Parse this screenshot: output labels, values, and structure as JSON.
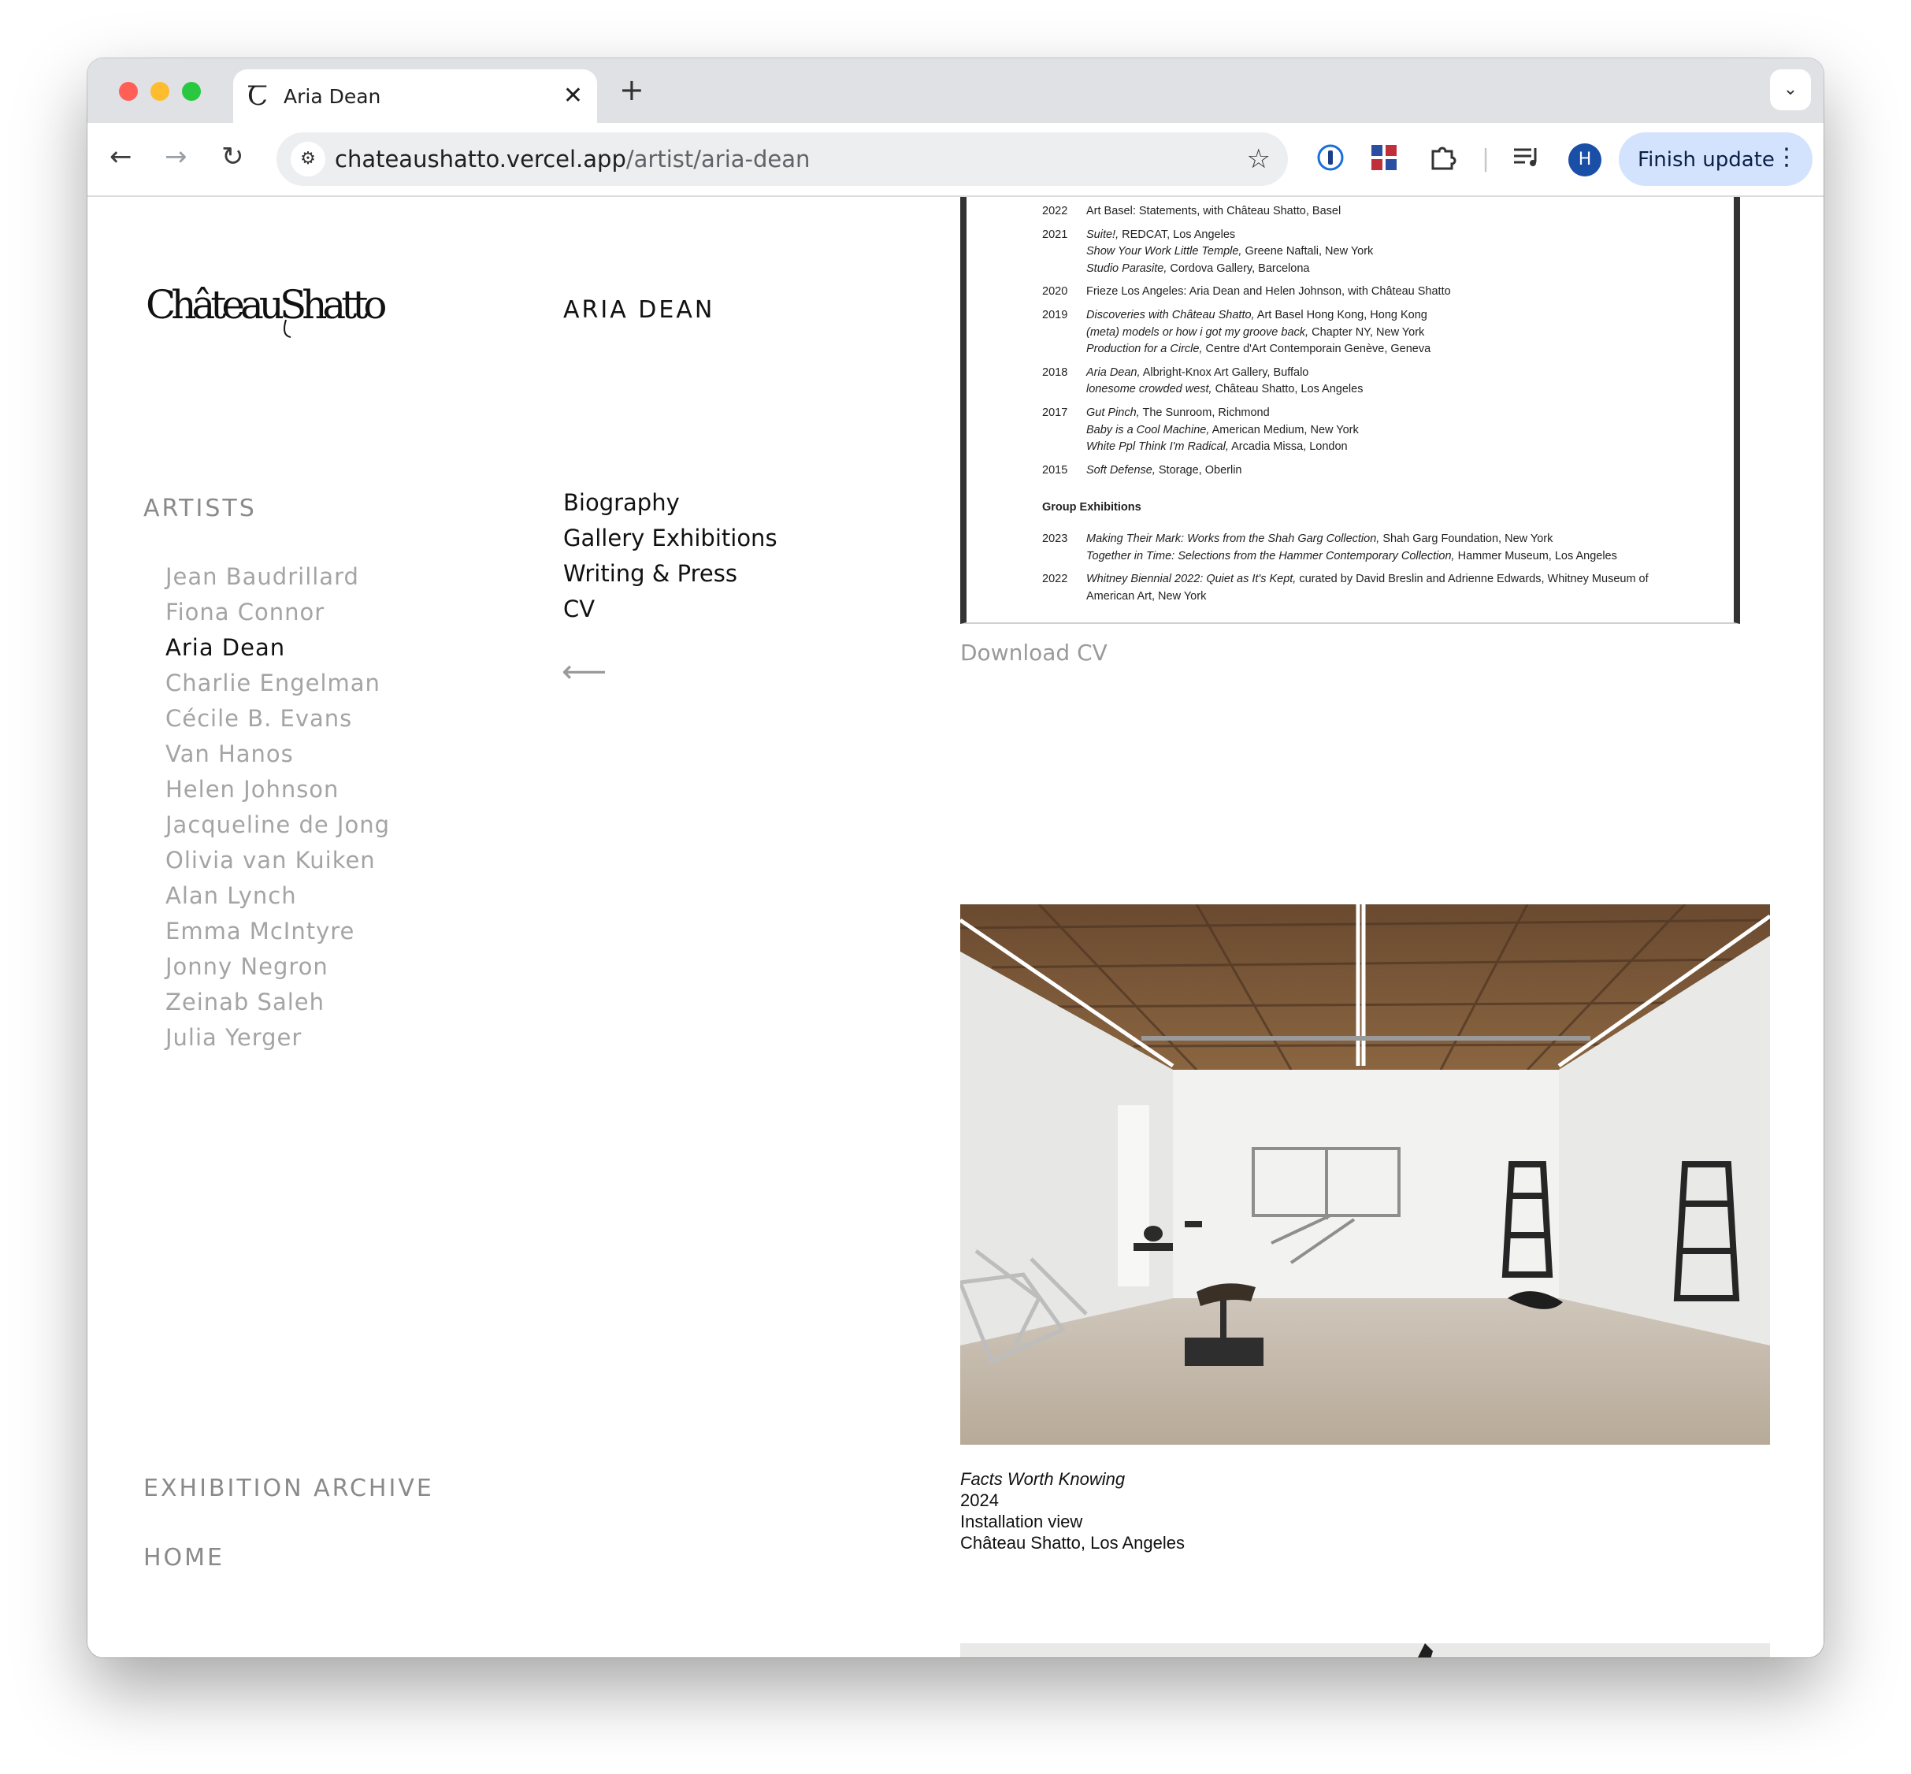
{
  "browser": {
    "tab_title": "Aria Dean",
    "tab_favicon": "Ꞇ",
    "url_host": "chateaushatto.vercel.app",
    "url_path": "/artist/aria-dean",
    "profile_initial": "H",
    "update_label": "Finish update"
  },
  "site": {
    "logo_text": "ChâteauShatto",
    "artists_heading": "ARTISTS",
    "artists": [
      "Jean Baudrillard",
      "Fiona Connor",
      "Aria Dean",
      "Charlie Engelman",
      "Cécile B. Evans",
      "Van Hanos",
      "Helen Johnson",
      "Jacqueline de Jong",
      "Olivia van Kuiken",
      "Alan Lynch",
      "Emma McIntyre",
      "Jonny Negron",
      "Zeinab Saleh",
      "Julia Yerger"
    ],
    "active_artist": "Aria Dean",
    "exhibition_archive": "EXHIBITION ARCHIVE",
    "home": "HOME"
  },
  "artist": {
    "name": "ARIA DEAN",
    "subnav": [
      "Biography",
      "Gallery Exhibitions",
      "Writing & Press",
      "CV"
    ],
    "back_arrow": "⟵"
  },
  "cv": {
    "solo": [
      {
        "year": "2022",
        "lines": [
          [
            {
              "t": "Art Basel: Statements, with Château Shatto, Basel"
            }
          ]
        ]
      },
      {
        "year": "2021",
        "lines": [
          [
            {
              "i": "Suite!,"
            },
            {
              "t": " REDCAT, Los Angeles"
            }
          ],
          [
            {
              "i": "Show Your Work Little Temple,"
            },
            {
              "t": " Greene Naftali, New York"
            }
          ],
          [
            {
              "i": "Studio Parasite,"
            },
            {
              "t": " Cordova Gallery, Barcelona"
            }
          ]
        ]
      },
      {
        "year": "2020",
        "lines": [
          [
            {
              "t": "Frieze Los Angeles: Aria Dean and Helen Johnson, with Château Shatto"
            }
          ]
        ]
      },
      {
        "year": "2019",
        "lines": [
          [
            {
              "i": "Discoveries with Château Shatto,"
            },
            {
              "t": " Art Basel Hong Kong, Hong Kong"
            }
          ],
          [
            {
              "i": "(meta) models or how i got my groove back,"
            },
            {
              "t": " Chapter NY, New York"
            }
          ],
          [
            {
              "i": "Production for a Circle,"
            },
            {
              "t": " Centre d'Art Contemporain Genève, Geneva"
            }
          ]
        ]
      },
      {
        "year": "2018",
        "lines": [
          [
            {
              "i": "Aria Dean,"
            },
            {
              "t": " Albright-Knox Art Gallery, Buffalo"
            }
          ],
          [
            {
              "i": "lonesome crowded west,"
            },
            {
              "t": " Château Shatto, Los Angeles"
            }
          ]
        ]
      },
      {
        "year": "2017",
        "lines": [
          [
            {
              "i": "Gut Pinch,"
            },
            {
              "t": " The Sunroom, Richmond"
            }
          ],
          [
            {
              "i": "Baby is a Cool Machine,"
            },
            {
              "t": " American Medium, New York"
            }
          ],
          [
            {
              "i": "White Ppl Think I'm Radical,"
            },
            {
              "t": " Arcadia Missa, London"
            }
          ]
        ]
      },
      {
        "year": "2015",
        "lines": [
          [
            {
              "i": "Soft Defense,"
            },
            {
              "t": " Storage, Oberlin"
            }
          ]
        ]
      }
    ],
    "group_heading": "Group Exhibitions",
    "group": [
      {
        "year": "2023",
        "lines": [
          [
            {
              "i": "Making Their Mark: Works from the Shah Garg Collection,"
            },
            {
              "t": " Shah Garg Foundation, New York"
            }
          ],
          [
            {
              "i": "Together in Time: Selections from the Hammer Contemporary Collection,"
            },
            {
              "t": " Hammer Museum, Los Angeles"
            }
          ]
        ]
      },
      {
        "year": "2022",
        "lines": [
          [
            {
              "i": "Whitney Biennial 2022: Quiet as It's Kept,"
            },
            {
              "t": " curated by David Breslin and Adrienne Edwards, Whitney Museum of"
            }
          ],
          [
            {
              "t": "American Art, New York"
            }
          ]
        ]
      }
    ],
    "download_label": "Download CV"
  },
  "caption": {
    "title": "Facts Worth Knowing",
    "year": "2024",
    "type": "Installation view",
    "venue": "Château Shatto, Los Angeles"
  }
}
